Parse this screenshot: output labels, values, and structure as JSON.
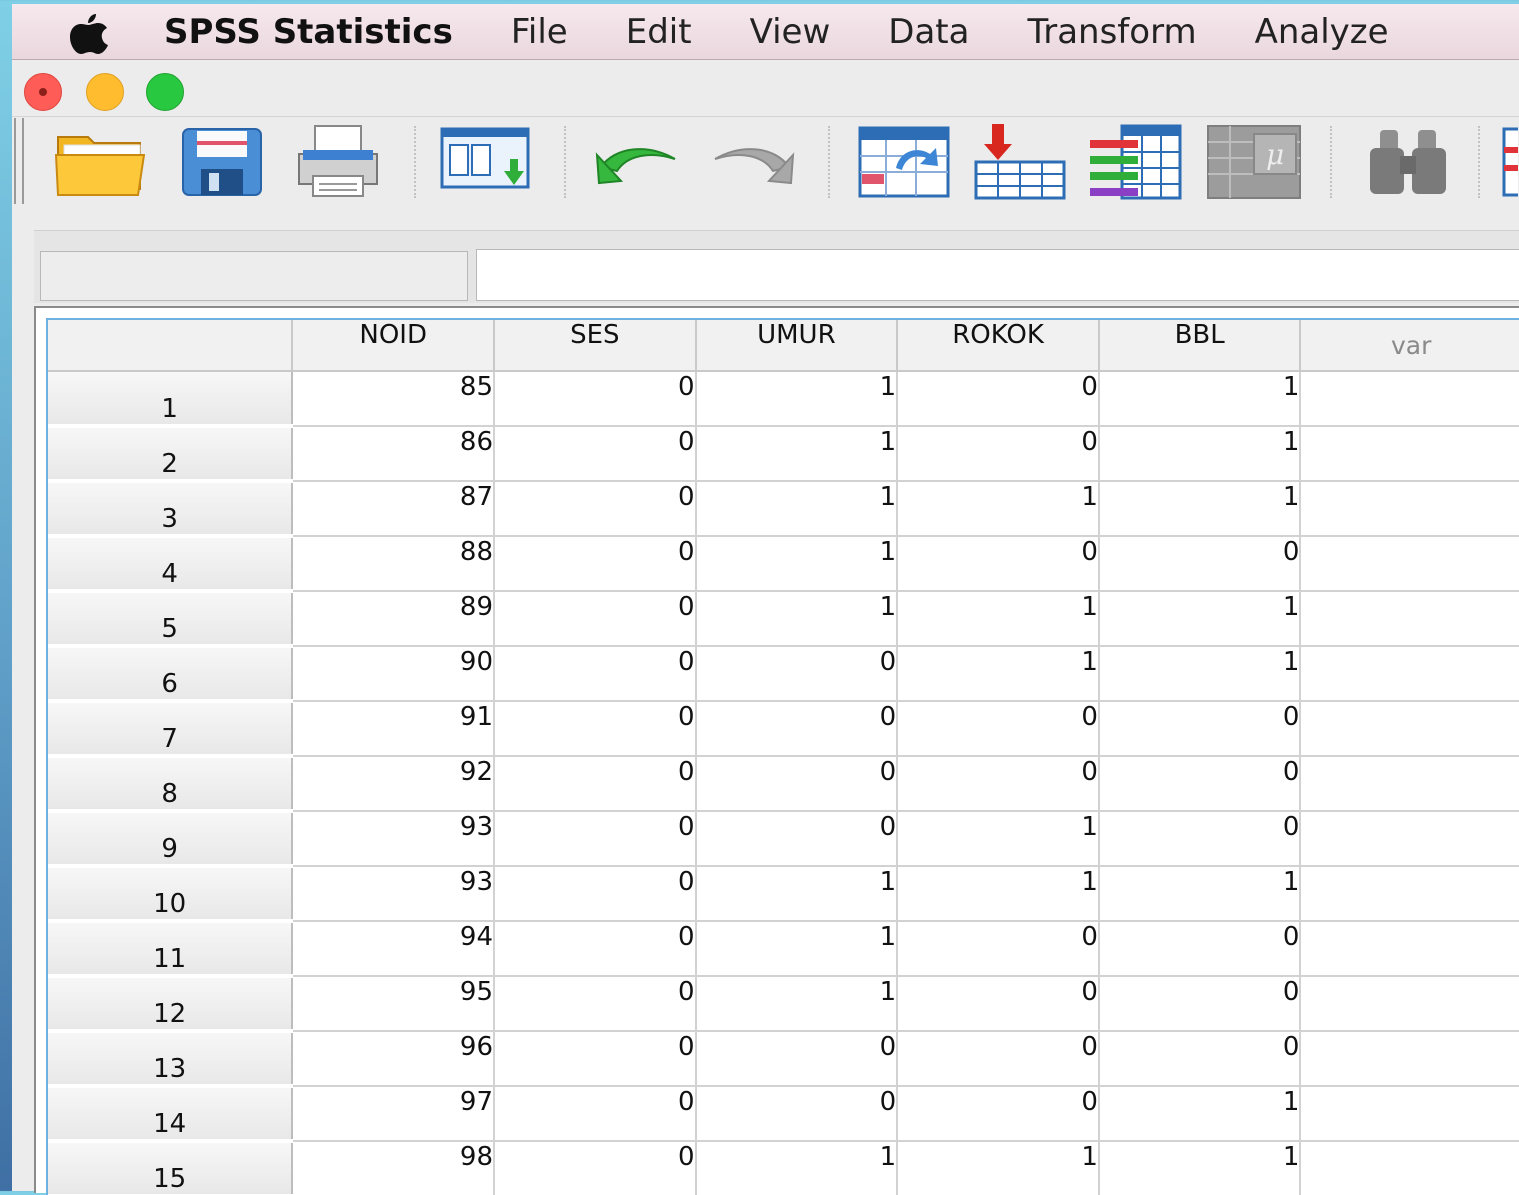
{
  "menubar": {
    "app_name": "SPSS Statistics",
    "items": [
      "File",
      "Edit",
      "View",
      "Data",
      "Transform",
      "Analyze"
    ]
  },
  "toolbar": {
    "buttons": [
      {
        "icon": "open-folder-icon",
        "label": ""
      },
      {
        "icon": "save-icon",
        "label": ""
      },
      {
        "icon": "print-icon",
        "label": ""
      },
      {
        "icon": "recall-dialog-icon",
        "label": ""
      },
      {
        "icon": "undo-icon",
        "label": ""
      },
      {
        "icon": "redo-icon",
        "label": ""
      },
      {
        "icon": "goto-case-icon",
        "label": ""
      },
      {
        "icon": "goto-variable-icon",
        "label": ""
      },
      {
        "icon": "variables-icon",
        "label": ""
      },
      {
        "icon": "run-descriptives-icon",
        "label": ""
      },
      {
        "icon": "find-icon",
        "label": ""
      }
    ]
  },
  "cell_editor": {
    "reference": "",
    "value": ""
  },
  "grid": {
    "columns": [
      "NOID",
      "SES",
      "UMUR",
      "ROKOK",
      "BBL"
    ],
    "empty_column": "var",
    "rows": [
      {
        "n": "1",
        "values": [
          "85",
          "0",
          "1",
          "0",
          "1"
        ]
      },
      {
        "n": "2",
        "values": [
          "86",
          "0",
          "1",
          "0",
          "1"
        ]
      },
      {
        "n": "3",
        "values": [
          "87",
          "0",
          "1",
          "1",
          "1"
        ]
      },
      {
        "n": "4",
        "values": [
          "88",
          "0",
          "1",
          "0",
          "0"
        ]
      },
      {
        "n": "5",
        "values": [
          "89",
          "0",
          "1",
          "1",
          "1"
        ]
      },
      {
        "n": "6",
        "values": [
          "90",
          "0",
          "0",
          "1",
          "1"
        ]
      },
      {
        "n": "7",
        "values": [
          "91",
          "0",
          "0",
          "0",
          "0"
        ]
      },
      {
        "n": "8",
        "values": [
          "92",
          "0",
          "0",
          "0",
          "0"
        ]
      },
      {
        "n": "9",
        "values": [
          "93",
          "0",
          "0",
          "1",
          "0"
        ]
      },
      {
        "n": "10",
        "values": [
          "93",
          "0",
          "1",
          "1",
          "1"
        ]
      },
      {
        "n": "11",
        "values": [
          "94",
          "0",
          "1",
          "0",
          "0"
        ]
      },
      {
        "n": "12",
        "values": [
          "95",
          "0",
          "1",
          "0",
          "0"
        ]
      },
      {
        "n": "13",
        "values": [
          "96",
          "0",
          "0",
          "0",
          "0"
        ]
      },
      {
        "n": "14",
        "values": [
          "97",
          "0",
          "0",
          "0",
          "1"
        ]
      },
      {
        "n": "15",
        "values": [
          "98",
          "0",
          "1",
          "1",
          "1"
        ]
      }
    ]
  }
}
